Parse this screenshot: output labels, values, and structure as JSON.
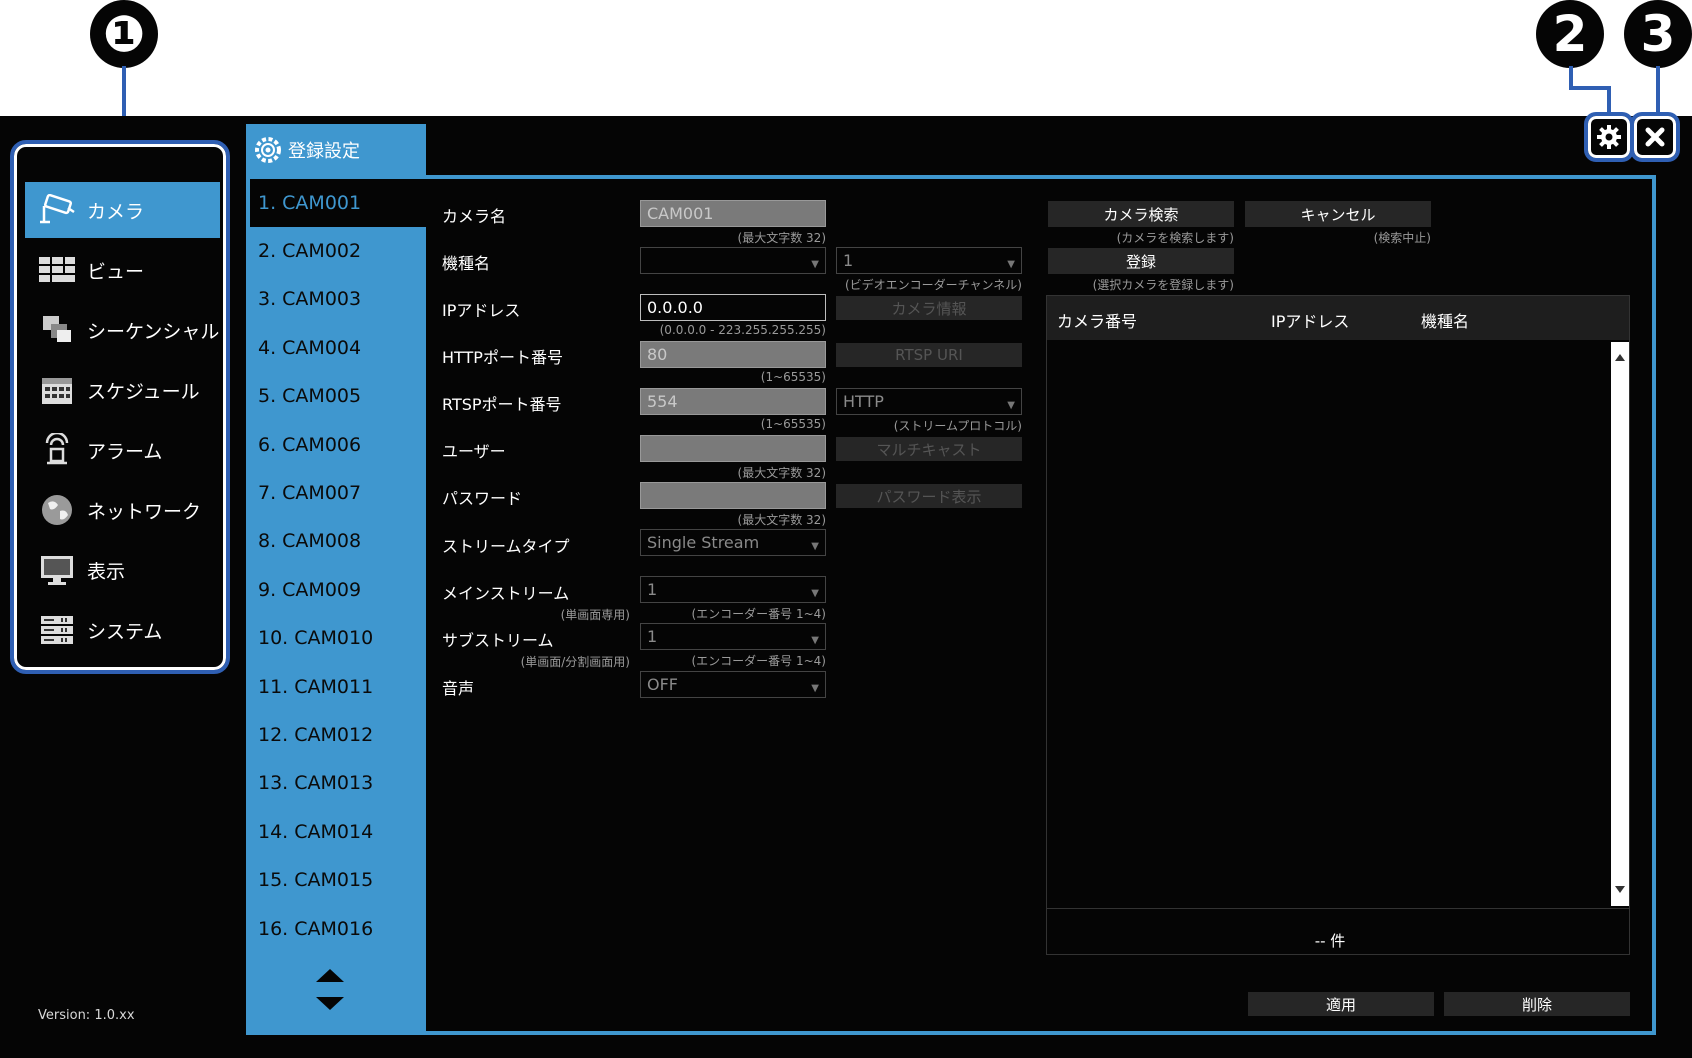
{
  "callouts": [
    "❶",
    "2",
    "3"
  ],
  "version": "Version: 1.0.xx",
  "nav": {
    "items": [
      {
        "label": "カメラ",
        "icon": "camera-icon",
        "active": true
      },
      {
        "label": "ビュー",
        "icon": "view-icon"
      },
      {
        "label": "シーケンシャル",
        "icon": "sequential-icon"
      },
      {
        "label": "スケジュール",
        "icon": "schedule-icon"
      },
      {
        "label": "アラーム",
        "icon": "alarm-icon"
      },
      {
        "label": "ネットワーク",
        "icon": "network-icon"
      },
      {
        "label": "表示",
        "icon": "display-icon"
      },
      {
        "label": "システム",
        "icon": "system-icon"
      }
    ]
  },
  "tab": {
    "label": "登録設定",
    "icon": "gear-icon"
  },
  "cameras": [
    "1. CAM001",
    "2. CAM002",
    "3. CAM003",
    "4. CAM004",
    "5. CAM005",
    "6. CAM006",
    "7. CAM007",
    "8. CAM008",
    "9. CAM009",
    "10. CAM010",
    "11. CAM011",
    "12. CAM012",
    "13. CAM013",
    "14. CAM014",
    "15. CAM015",
    "16. CAM016"
  ],
  "form": {
    "camera_name": {
      "label": "カメラ名",
      "value": "CAM001",
      "hint": "(最大文字数 32)"
    },
    "model": {
      "label": "機種名",
      "value": "",
      "channel": "1",
      "channel_hint": "(ビデオエンコーダーチャンネル)"
    },
    "ip": {
      "label": "IPアドレス",
      "value": "0.0.0.0",
      "hint": "(0.0.0.0 - 223.255.255.255)"
    },
    "http_port": {
      "label": "HTTPポート番号",
      "value": "80",
      "hint": "(1~65535)"
    },
    "rtsp_port": {
      "label": "RTSPポート番号",
      "value": "554",
      "hint": "(1~65535)",
      "protocol": "HTTP",
      "protocol_hint": "(ストリームプロトコル)"
    },
    "user": {
      "label": "ユーザー",
      "value": "",
      "hint": "(最大文字数 32)"
    },
    "password": {
      "label": "パスワード",
      "value": "",
      "hint": "(最大文字数 32)"
    },
    "stream_type": {
      "label": "ストリームタイプ",
      "value": "Single Stream"
    },
    "main_stream": {
      "label": "メインストリーム",
      "sub": "(単画面専用)",
      "value": "1",
      "hint": "(エンコーダー番号 1~4)"
    },
    "sub_stream": {
      "label": "サブストリーム",
      "sub": "(単画面/分割画面用)",
      "value": "1",
      "hint": "(エンコーダー番号 1~4)"
    },
    "audio": {
      "label": "音声",
      "value": "OFF"
    }
  },
  "buttons": {
    "camera_info": "カメラ情報",
    "rtsp_uri": "RTSP URI",
    "multicast": "マルチキャスト",
    "show_password": "パスワード表示",
    "camera_search": "カメラ検索",
    "camera_search_hint": "(カメラを検索します)",
    "cancel": "キャンセル",
    "cancel_hint": "(検索中止)",
    "register": "登録",
    "register_hint": "(選択カメラを登録します)",
    "apply": "適用",
    "delete": "削除"
  },
  "results": {
    "columns": [
      "カメラ番号",
      "IPアドレス",
      "機種名"
    ],
    "count": "-- 件"
  },
  "colors": {
    "accent": "#3f97cf",
    "callout": "#2f5fb3",
    "background": "#050505"
  }
}
